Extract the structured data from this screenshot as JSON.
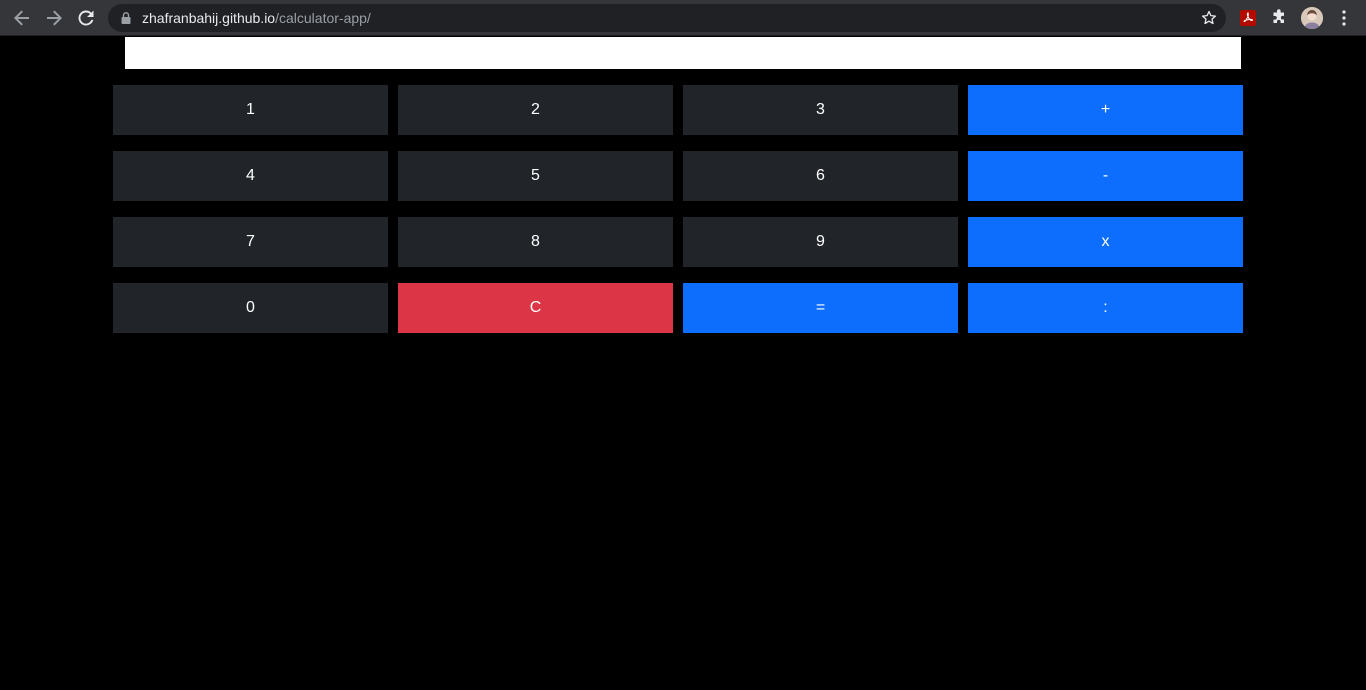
{
  "browser": {
    "url_host": "zhafranbahij.github.io",
    "url_path": "/calculator-app/",
    "icons": {
      "back": "arrow-left-icon",
      "forward": "arrow-right-icon",
      "reload": "reload-icon",
      "lock": "lock-icon",
      "bookmark": "star-icon",
      "pdf_extension": "acrobat-pdf-icon",
      "extensions": "puzzle-icon",
      "profile": "avatar",
      "menu": "kebab-menu-icon"
    }
  },
  "calculator": {
    "display_value": "",
    "keys": [
      {
        "label": "1",
        "style": "dark"
      },
      {
        "label": "2",
        "style": "dark"
      },
      {
        "label": "3",
        "style": "dark"
      },
      {
        "label": "+",
        "style": "blue"
      },
      {
        "label": "4",
        "style": "dark"
      },
      {
        "label": "5",
        "style": "dark"
      },
      {
        "label": "6",
        "style": "dark"
      },
      {
        "label": "-",
        "style": "blue"
      },
      {
        "label": "7",
        "style": "dark"
      },
      {
        "label": "8",
        "style": "dark"
      },
      {
        "label": "9",
        "style": "dark"
      },
      {
        "label": "x",
        "style": "blue"
      },
      {
        "label": "0",
        "style": "dark"
      },
      {
        "label": "C",
        "style": "red"
      },
      {
        "label": "=",
        "style": "blue"
      },
      {
        "label": ":",
        "style": "blue"
      }
    ]
  },
  "colors": {
    "page_background": "#000000",
    "display_background": "#ffffff",
    "dark_key": "#212529",
    "blue_key": "#0d6efd",
    "red_key": "#dc3545",
    "key_text": "#ffffff",
    "browser_toolbar": "#35363a",
    "omnibox": "#202124"
  }
}
